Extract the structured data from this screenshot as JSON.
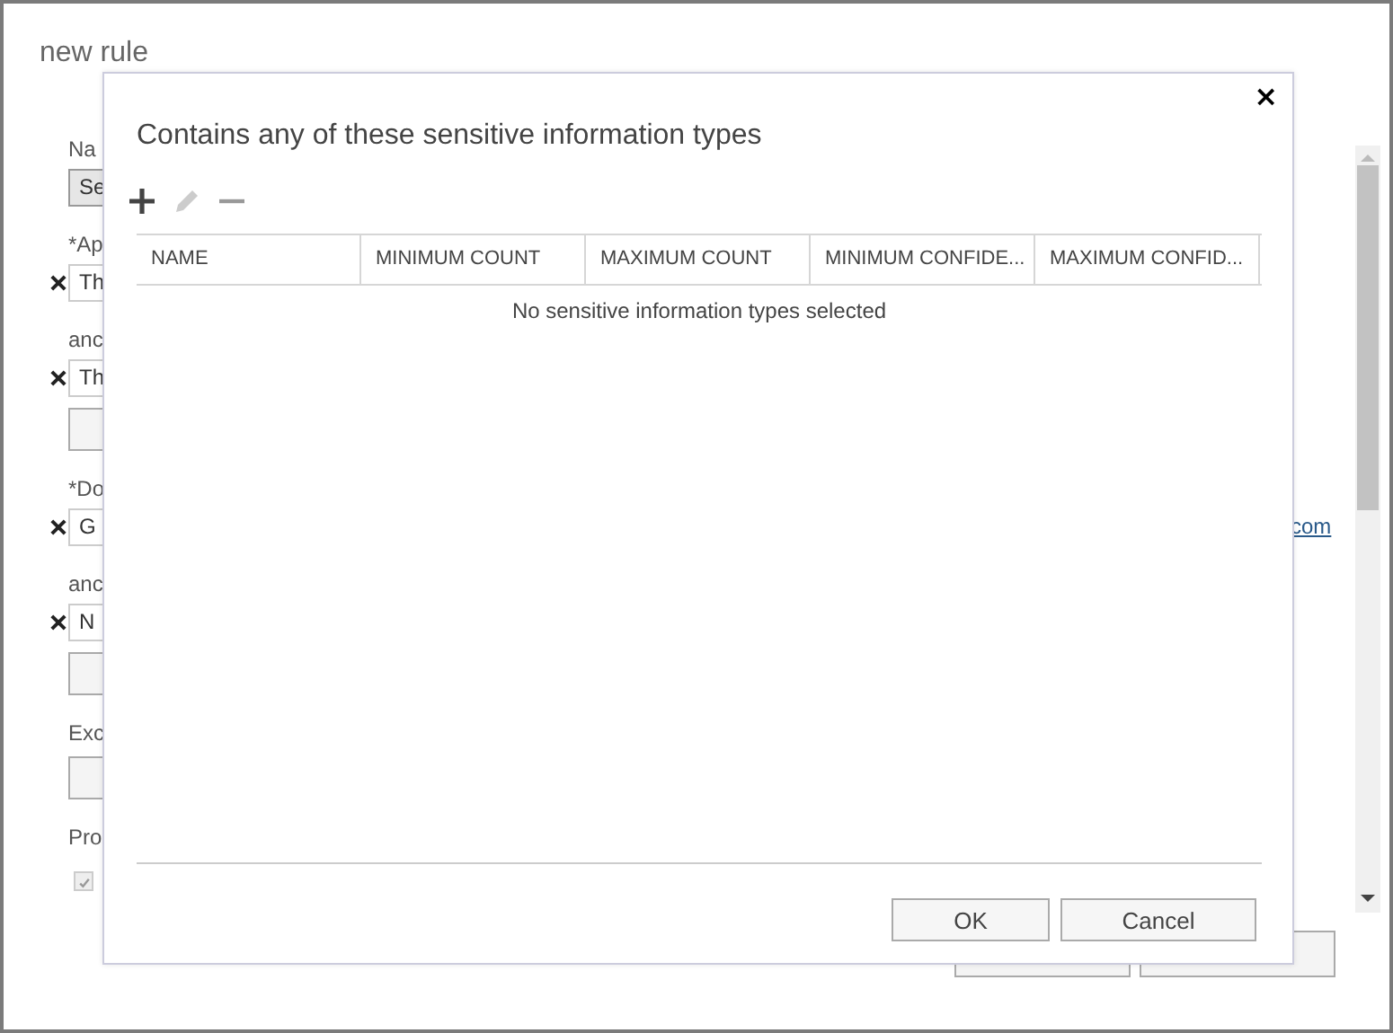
{
  "background": {
    "title": "new rule",
    "items": [
      {
        "kind": "label",
        "text": "Na"
      },
      {
        "kind": "field",
        "text": "Se",
        "removable": false,
        "focused": true
      },
      {
        "kind": "label",
        "text": "*Ap"
      },
      {
        "kind": "field",
        "text": "Th",
        "removable": true,
        "focused": false
      },
      {
        "kind": "label",
        "text": "anc"
      },
      {
        "kind": "field",
        "text": "Th",
        "removable": true,
        "focused": false
      },
      {
        "kind": "box"
      },
      {
        "kind": "label",
        "text": "*Do"
      },
      {
        "kind": "field",
        "text": "G",
        "removable": true,
        "focused": false
      },
      {
        "kind": "label",
        "text": "anc"
      },
      {
        "kind": "field",
        "text": "N",
        "removable": true,
        "focused": false
      },
      {
        "kind": "box"
      },
      {
        "kind": "label",
        "text": "Exc"
      },
      {
        "kind": "box"
      },
      {
        "kind": "label",
        "text": "Pro"
      },
      {
        "kind": "checkbox",
        "checked": true
      }
    ],
    "link": "com"
  },
  "dialog": {
    "title": "Contains any of these sensitive information types",
    "close": "×",
    "toolbar": [
      {
        "kind": "add",
        "disabled": false
      },
      {
        "kind": "edit",
        "disabled": true
      },
      {
        "kind": "remove",
        "disabled": true
      }
    ],
    "columns": [
      "NAME",
      "MINIMUM COUNT",
      "MAXIMUM COUNT",
      "MINIMUM CONFIDE...",
      "MAXIMUM CONFID..."
    ],
    "empty_message": "No sensitive information types selected",
    "buttons": [
      "OK",
      "Cancel"
    ]
  }
}
